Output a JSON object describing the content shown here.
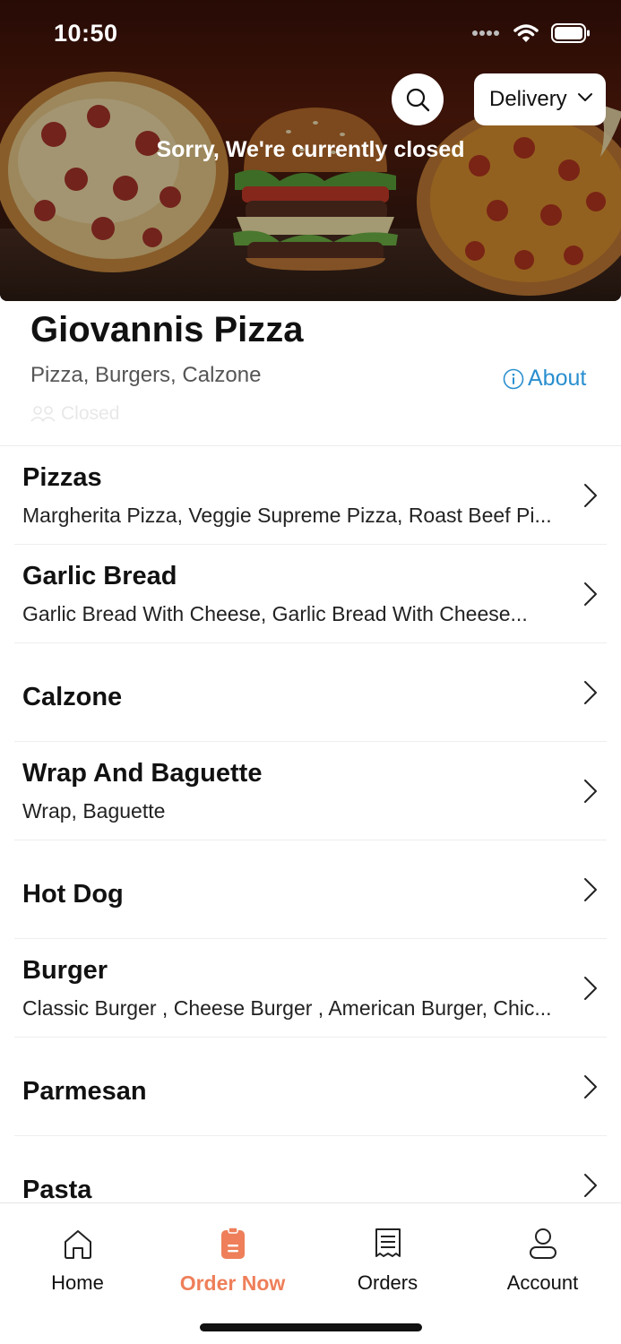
{
  "status_bar": {
    "time": "10:50"
  },
  "hero": {
    "closed_message": "Sorry, We're currently closed",
    "delivery_mode": "Delivery"
  },
  "restaurant": {
    "name": "Giovannis Pizza",
    "cuisines": "Pizza, Burgers, Calzone",
    "about_label": "About",
    "status": "Closed"
  },
  "menu": [
    {
      "title": "Pizzas",
      "subtitle": "Margherita Pizza, Veggie Supreme Pizza, Roast Beef Pi..."
    },
    {
      "title": "Garlic Bread",
      "subtitle": "Garlic Bread With Cheese, Garlic Bread With Cheese..."
    },
    {
      "title": "Calzone",
      "subtitle": ""
    },
    {
      "title": "Wrap And Baguette",
      "subtitle": "Wrap, Baguette"
    },
    {
      "title": "Hot Dog",
      "subtitle": ""
    },
    {
      "title": "Burger",
      "subtitle": "Classic Burger , Cheese Burger , American Burger, Chic..."
    },
    {
      "title": "Parmesan",
      "subtitle": ""
    },
    {
      "title": "Pasta",
      "subtitle": ""
    }
  ],
  "tabs": [
    {
      "label": "Home",
      "icon": "home-icon",
      "active": false
    },
    {
      "label": "Order Now",
      "icon": "order-icon",
      "active": true
    },
    {
      "label": "Orders",
      "icon": "receipt-icon",
      "active": false
    },
    {
      "label": "Account",
      "icon": "person-icon",
      "active": false
    }
  ],
  "colors": {
    "accent": "#ee7f5a",
    "link": "#2a8fcf",
    "text": "#111111",
    "muted": "#555555"
  }
}
